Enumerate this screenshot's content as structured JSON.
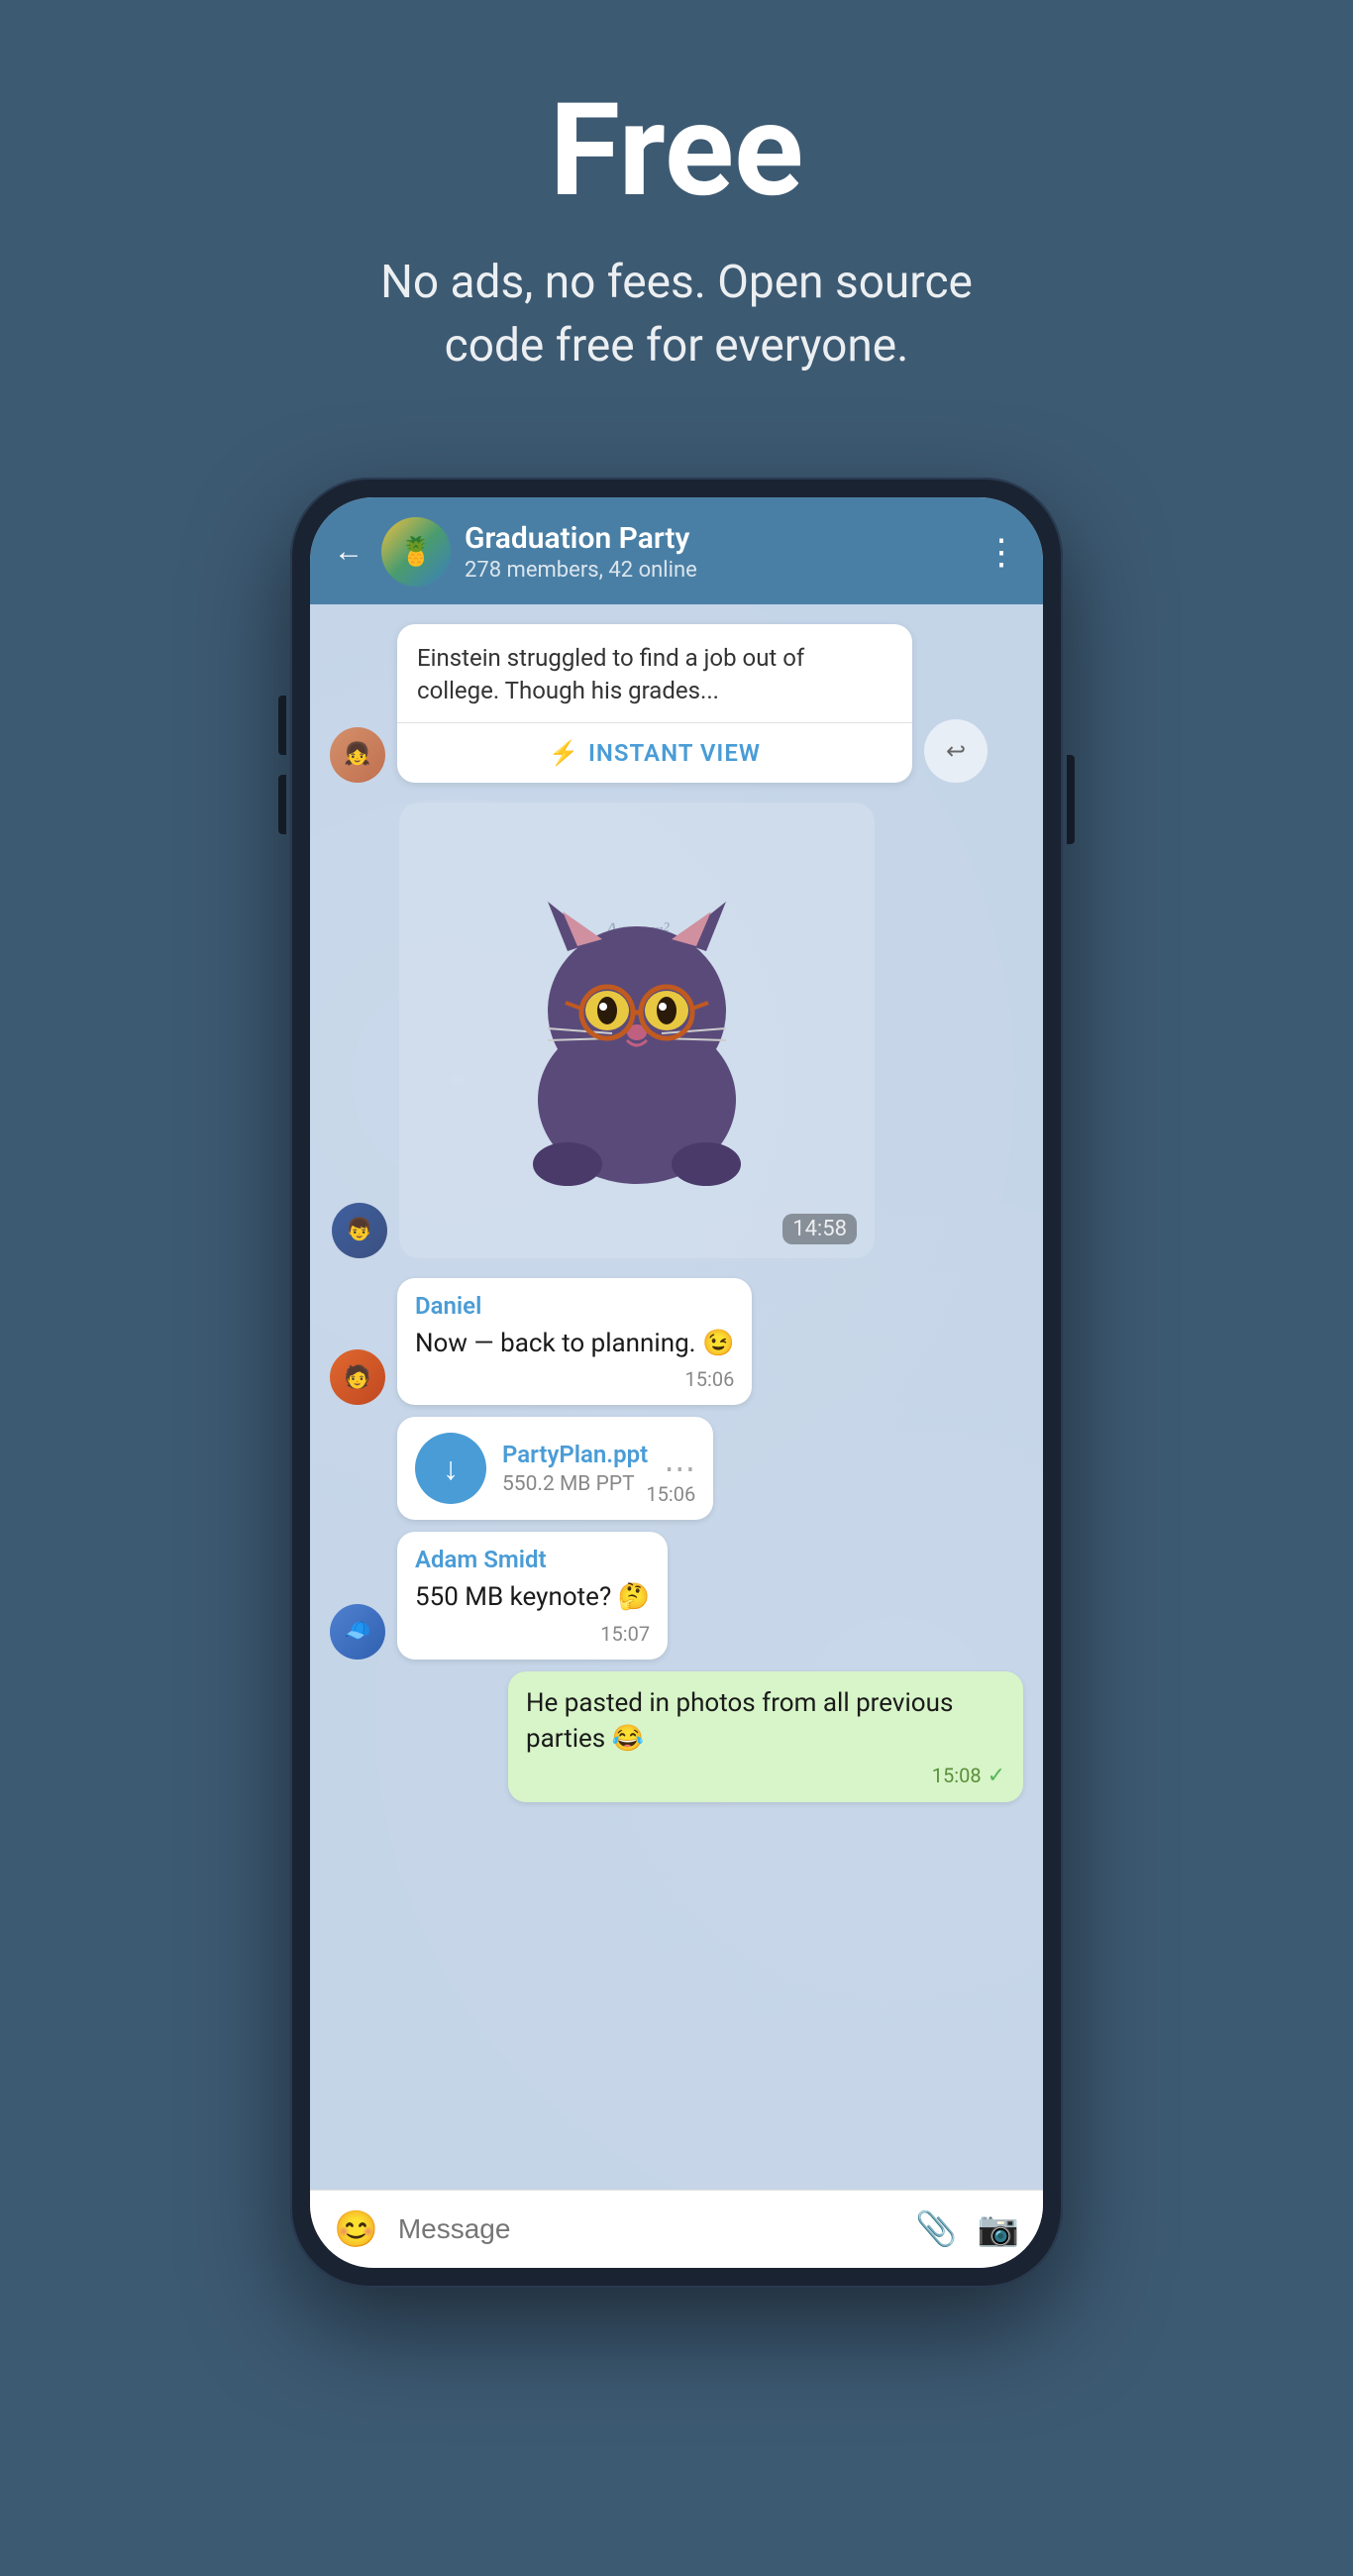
{
  "hero": {
    "title": "Free",
    "subtitle": "No ads, no fees. Open source code free for everyone."
  },
  "chat": {
    "group_name": "Graduation Party",
    "members_info": "278 members, 42 online",
    "back_label": "←",
    "more_label": "⋮"
  },
  "messages": [
    {
      "type": "article",
      "text": "Einstein struggled to find a job out of college. Though his grades...",
      "instant_view_label": "INSTANT VIEW",
      "share_icon": "↩"
    },
    {
      "type": "sticker",
      "time": "14:58"
    },
    {
      "type": "text",
      "sender": "Daniel",
      "sender_color": "#4a9cd6",
      "text": "Now — back to planning. 😉",
      "time": "15:06"
    },
    {
      "type": "file",
      "filename": "PartyPlan.ppt",
      "filesize": "550.2 MB PPT",
      "time": "15:06",
      "download_icon": "↓"
    },
    {
      "type": "text",
      "sender": "Adam Smidt",
      "sender_color": "#4a9cd6",
      "text": "550 MB keynote? 🤔",
      "time": "15:07"
    },
    {
      "type": "own",
      "text": "He pasted in photos from all previous parties 😂",
      "time": "15:08",
      "read": true
    }
  ],
  "input": {
    "placeholder": "Message",
    "emoji_icon": "😊",
    "attach_icon": "📎",
    "camera_icon": "📷"
  },
  "avatars": {
    "group": "🍍",
    "user1_bg": "#c0956a",
    "user2_bg": "#3a6ea8",
    "user3_bg": "#e06830",
    "user4_bg": "#5080c0"
  }
}
